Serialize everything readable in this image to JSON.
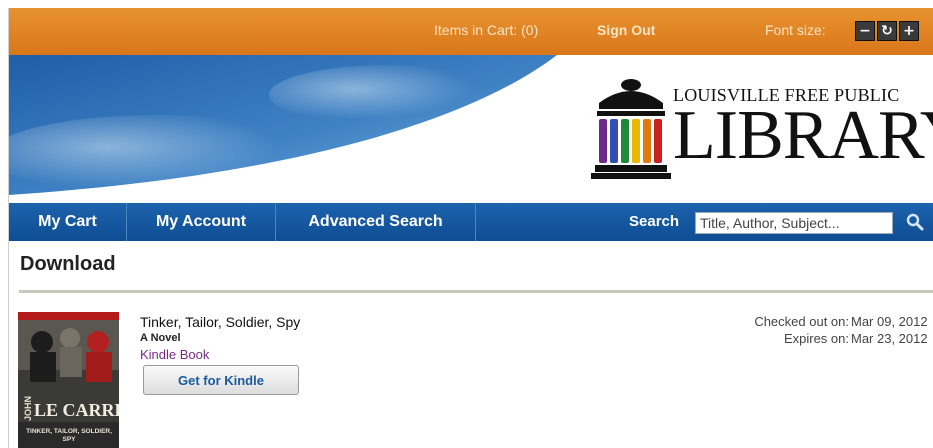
{
  "topbar": {
    "cart_label": "Items in Cart: (0)",
    "signout_label": "Sign Out",
    "font_size_label": "Font size:",
    "font_buttons": {
      "decrease": "−",
      "reset": "↻",
      "increase": "+"
    }
  },
  "logo": {
    "line1": "LOUISVILLE FREE PUBLIC",
    "line2": "LIBRARY",
    "stripe_colors": [
      "#6b2a8c",
      "#2f4fb4",
      "#1f8a3a",
      "#e6b800",
      "#e07a10",
      "#cc2020"
    ]
  },
  "nav": {
    "items": [
      {
        "label": "My Cart"
      },
      {
        "label": "My Account"
      },
      {
        "label": "Advanced Search"
      }
    ],
    "search_label": "Search",
    "search_placeholder": "Title, Author, Subject..."
  },
  "page": {
    "heading": "Download"
  },
  "item": {
    "title": "Tinker, Tailor, Soldier, Spy",
    "subtitle": "A Novel",
    "format": "Kindle Book",
    "action_label": "Get for Kindle",
    "checked_out_label": "Checked out on:",
    "checked_out_value": "Mar 09, 2012",
    "expires_label": "Expires on:",
    "expires_value": "Mar 23, 2012",
    "cover": {
      "author_first": "JOHN",
      "author_last": "LE CARRÉ",
      "title_text": "TINKER, TAILOR, SOLDIER, SPY"
    }
  },
  "colors": {
    "topbar": "#d9761a",
    "nav": "#0e4d93",
    "format_link": "#7a2b86",
    "button_text": "#1a5ba0"
  }
}
